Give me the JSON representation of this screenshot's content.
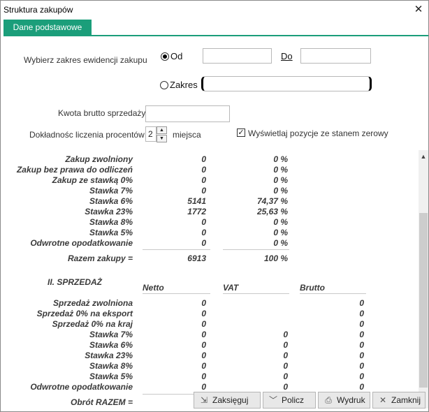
{
  "window": {
    "title": "Struktura zakupów",
    "close": "✕"
  },
  "tab": {
    "label": "Dane podstawowe"
  },
  "range": {
    "label": "Wybierz zakres ewidencji zakupu",
    "od_label": "Od",
    "do_label": "Do",
    "zakres_label": "Zakres",
    "od_value": "",
    "do_value": "",
    "zakres_value": ""
  },
  "kwota": {
    "label": "Kwota brutto sprzedaży",
    "value": ""
  },
  "precision": {
    "label": "Dokładnośc liczenia procentów",
    "value": "2",
    "suffix": "miejsca"
  },
  "zero_rows": {
    "label": "Wyświetlaj pozycje ze stanem zerowy",
    "checked": true
  },
  "purchases": {
    "rows": [
      {
        "name": "Zakup zwolniony",
        "value": "0",
        "pct": "0 %"
      },
      {
        "name": "Zakup bez prawa do odliczeń",
        "value": "0",
        "pct": "0 %"
      },
      {
        "name": "Zakup ze stawką 0%",
        "value": "0",
        "pct": "0 %"
      },
      {
        "name": "Stawka 7%",
        "value": "0",
        "pct": "0 %"
      },
      {
        "name": "Stawka 6%",
        "value": "5141",
        "pct": "74,37 %"
      },
      {
        "name": "Stawka 23%",
        "value": "1772",
        "pct": "25,63 %"
      },
      {
        "name": "Stawka 8%",
        "value": "0",
        "pct": "0 %"
      },
      {
        "name": "Stawka 5%",
        "value": "0",
        "pct": "0 %"
      },
      {
        "name": "Odwrotne opodatkowanie",
        "value": "0",
        "pct": "0 %"
      }
    ],
    "total": {
      "name": "Razem zakupy =",
      "value": "6913",
      "pct": "100 %"
    }
  },
  "sales": {
    "heading": "II.  SPRZEDAŻ",
    "columns": {
      "netto": "Netto",
      "vat": "VAT",
      "brutto": "Brutto"
    },
    "rows": [
      {
        "name": "Sprzedaż zwolniona",
        "netto": "0",
        "vat": "",
        "brutto": "0"
      },
      {
        "name": "Sprzedaż 0% na eksport",
        "netto": "0",
        "vat": "",
        "brutto": "0"
      },
      {
        "name": "Sprzedaż 0% na kraj",
        "netto": "0",
        "vat": "",
        "brutto": "0"
      },
      {
        "name": "Stawka 7%",
        "netto": "0",
        "vat": "0",
        "brutto": "0"
      },
      {
        "name": "Stawka 6%",
        "netto": "0",
        "vat": "0",
        "brutto": "0"
      },
      {
        "name": "Stawka 23%",
        "netto": "0",
        "vat": "0",
        "brutto": "0"
      },
      {
        "name": "Stawka 8%",
        "netto": "0",
        "vat": "0",
        "brutto": "0"
      },
      {
        "name": "Stawka 5%",
        "netto": "0",
        "vat": "0",
        "brutto": "0"
      },
      {
        "name": "Odwrotne opodatkowanie",
        "netto": "0",
        "vat": "0",
        "brutto": "0"
      }
    ],
    "total": {
      "name": "Obrót RAZEM ="
    }
  },
  "buttons": {
    "post": "Zaksięguj",
    "calc": "Policz",
    "print": "Wydruk",
    "close": "Zamknij"
  },
  "colors": {
    "tab": "#1b9e7a"
  }
}
